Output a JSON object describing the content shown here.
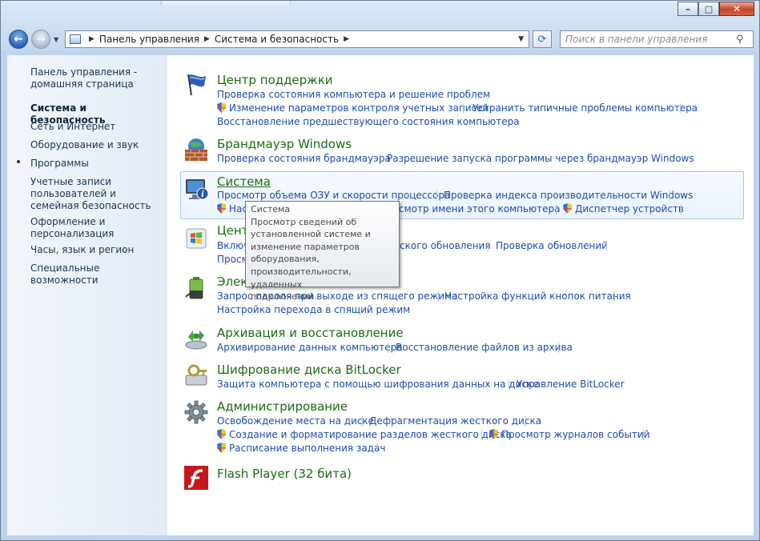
{
  "window": {
    "caption_buttons": {
      "minimize": "–",
      "maximize": "□",
      "close": "✕"
    }
  },
  "nav": {
    "back_icon": "back-arrow-icon",
    "forward_icon": "forward-arrow-icon",
    "breadcrumb": [
      "Панель управления",
      "Система и безопасность"
    ],
    "search_placeholder": "Поиск в панели управления"
  },
  "sidebar": {
    "home": "Панель управления - домашняя страница",
    "items": [
      {
        "label": "Система и безопасность",
        "active": true
      },
      {
        "label": "Сеть и Интернет"
      },
      {
        "label": "Оборудование и звук"
      },
      {
        "label": "Программы"
      },
      {
        "label": "Учетные записи пользователей и семейная безопасность"
      },
      {
        "label": "Оформление и персонализация"
      },
      {
        "label": "Часы, язык и регион"
      },
      {
        "label": "Специальные возможности"
      }
    ]
  },
  "categories": {
    "support": {
      "title": "Центр поддержки",
      "links": [
        "Проверка состояния компьютера и решение проблем",
        "Изменение параметров контроля учетных записей",
        "Устранить типичные проблемы компьютера",
        "Восстановление предшествующего состояния компьютера"
      ]
    },
    "firewall": {
      "title": "Брандмауэр Windows",
      "links": [
        "Проверка состояния брандмауэра",
        "Разрешение запуска программы через брандмауэр Windows"
      ]
    },
    "system": {
      "title": "Система",
      "links": [
        "Просмотр объема ОЗУ и скорости процессора",
        "Проверка индекса производительности Windows",
        "Нас",
        "смотр имени этого компьютера",
        "Диспетчер устройств"
      ]
    },
    "update": {
      "title": "Цент",
      "links": [
        "Включ",
        "ского обновления",
        "Проверка обновлений",
        "Просм"
      ]
    },
    "power": {
      "title": "Элек",
      "links": [
        "Запрос пароля при выходе из спящего режима",
        "Настройка функций кнопок питания",
        "Настройка перехода в спящий режим"
      ]
    },
    "backup": {
      "title": "Архивация и восстановление",
      "links": [
        "Архивирование данных компьютера",
        "Восстановление файлов из архива"
      ]
    },
    "bitlocker": {
      "title": "Шифрование диска BitLocker",
      "links": [
        "Защита компьютера с помощью шифрования данных на диске",
        "Управление BitLocker"
      ]
    },
    "admin": {
      "title": "Администрирование",
      "links": [
        "Освобождение места на диске",
        "Дефрагментация жесткого диска",
        "Создание и форматирование разделов жесткого диска",
        "Просмотр журналов событий",
        "Расписание выполнения задач"
      ]
    },
    "flash": {
      "title": "Flash Player (32 бита)"
    }
  },
  "tooltip": {
    "title": "Система",
    "lines": [
      "Просмотр сведений об",
      "установленной системе и",
      "изменение параметров",
      "оборудования,",
      "производительности, удаленных",
      "подключений."
    ]
  },
  "colors": {
    "category_title": "#1e6b16",
    "link": "#1c4cad",
    "sidebar_text": "#1f3551"
  }
}
